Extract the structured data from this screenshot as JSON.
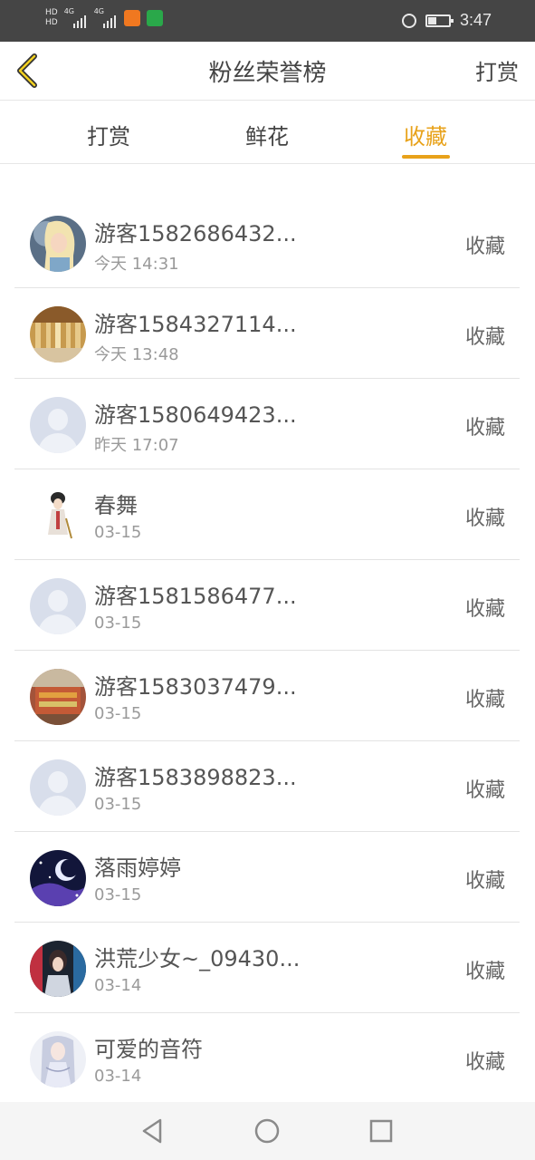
{
  "status_bar": {
    "hd1": "HD",
    "hd2": "HD",
    "sim1_badge": "4G",
    "sim2_badge": "4G",
    "time": "3:47",
    "battery_level": 0.4,
    "icons": [
      "hd-icon",
      "signal-icon",
      "signal-icon",
      "uc-browser-icon",
      "app-icon",
      "alarm-icon",
      "battery-icon"
    ]
  },
  "header": {
    "title": "粉丝荣誉榜",
    "action_label": "打赏",
    "back_icon": "chevron-left-icon",
    "accent_color": "#e8a21a"
  },
  "tabs": [
    {
      "label": "打赏",
      "active": false
    },
    {
      "label": "鲜花",
      "active": false
    },
    {
      "label": "收藏",
      "active": true
    }
  ],
  "list": [
    {
      "name": "游客1582686432...",
      "time": "今天 14:31",
      "action": "收藏",
      "avatar": "photo-frozen"
    },
    {
      "name": "游客1584327114...",
      "time": "今天 13:48",
      "action": "收藏",
      "avatar": "photo-hall"
    },
    {
      "name": "游客1580649423...",
      "time": "昨天 17:07",
      "action": "收藏",
      "avatar": "default"
    },
    {
      "name": "春舞",
      "time": "03-15",
      "action": "收藏",
      "avatar": "photo-figure"
    },
    {
      "name": "游客1581586477...",
      "time": "03-15",
      "action": "收藏",
      "avatar": "default"
    },
    {
      "name": "游客1583037479...",
      "time": "03-15",
      "action": "收藏",
      "avatar": "photo-building"
    },
    {
      "name": "游客1583898823...",
      "time": "03-15",
      "action": "收藏",
      "avatar": "default"
    },
    {
      "name": "落雨婷婷",
      "time": "03-15",
      "action": "收藏",
      "avatar": "photo-night"
    },
    {
      "name": "洪荒少女~_09430...",
      "time": "03-14",
      "action": "收藏",
      "avatar": "photo-girl"
    },
    {
      "name": "可爱的音符",
      "time": "03-14",
      "action": "收藏",
      "avatar": "photo-anime"
    }
  ],
  "nav_bar": {
    "icons": [
      "back-triangle-icon",
      "home-circle-icon",
      "recents-square-icon"
    ]
  }
}
